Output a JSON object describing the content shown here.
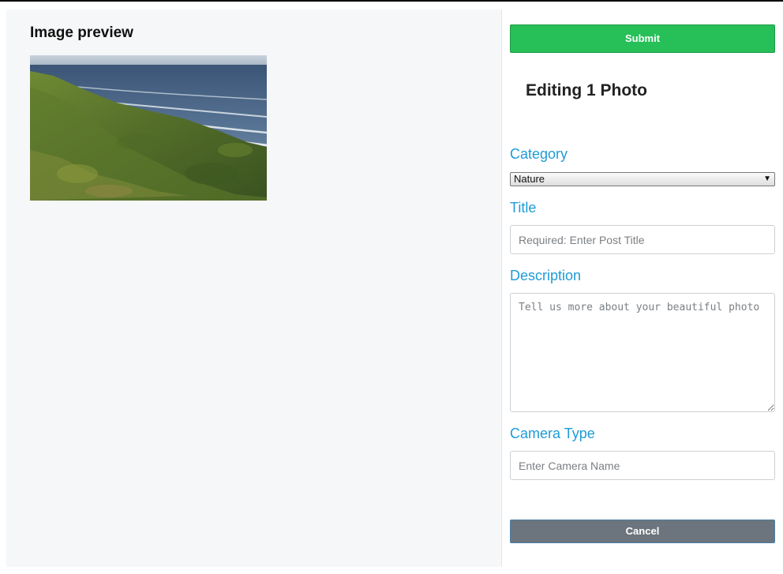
{
  "preview": {
    "heading": "Image preview",
    "image_icon": "coastal-landscape-photo"
  },
  "form": {
    "submit_label": "Submit",
    "heading": "Editing 1 Photo",
    "category": {
      "label": "Category",
      "selected": "Nature"
    },
    "title": {
      "label": "Title",
      "value": "",
      "placeholder": "Required: Enter Post Title"
    },
    "description": {
      "label": "Description",
      "value": "",
      "placeholder": "Tell us more about your beautiful photo"
    },
    "camera": {
      "label": "Camera Type",
      "value": "",
      "placeholder": "Enter Camera Name"
    },
    "cancel_label": "Cancel"
  },
  "colors": {
    "submit": "#26bf58",
    "cancel": "#6c757d",
    "label": "#1e9bd7",
    "panel": "#f6f7f9"
  }
}
